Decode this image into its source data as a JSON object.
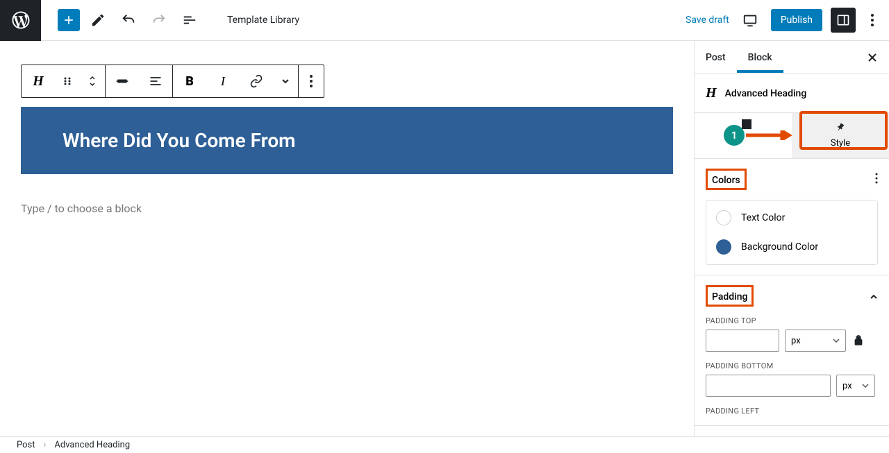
{
  "topbar": {
    "template_library": "Template Library",
    "save_draft": "Save draft",
    "publish": "Publish"
  },
  "editor": {
    "heading_text": "Where Did You Come From",
    "placeholder": "Type / to choose a block",
    "heading_bg": "#2e5f96"
  },
  "sidebar": {
    "tabs": {
      "post": "Post",
      "block": "Block"
    },
    "block_name": "Advanced Heading",
    "style_tab": "Style",
    "sections": {
      "colors": {
        "title": "Colors",
        "text_color": "Text Color",
        "background_color": "Background Color",
        "bg_value": "#2e5f96"
      },
      "padding": {
        "title": "Padding",
        "top_label": "PADDING TOP",
        "bottom_label": "PADDING BOTTOM",
        "left_label": "PADDING LEFT",
        "unit": "px"
      }
    }
  },
  "breadcrumb": {
    "post": "Post",
    "block": "Advanced Heading"
  },
  "annotation": {
    "step": "1"
  }
}
